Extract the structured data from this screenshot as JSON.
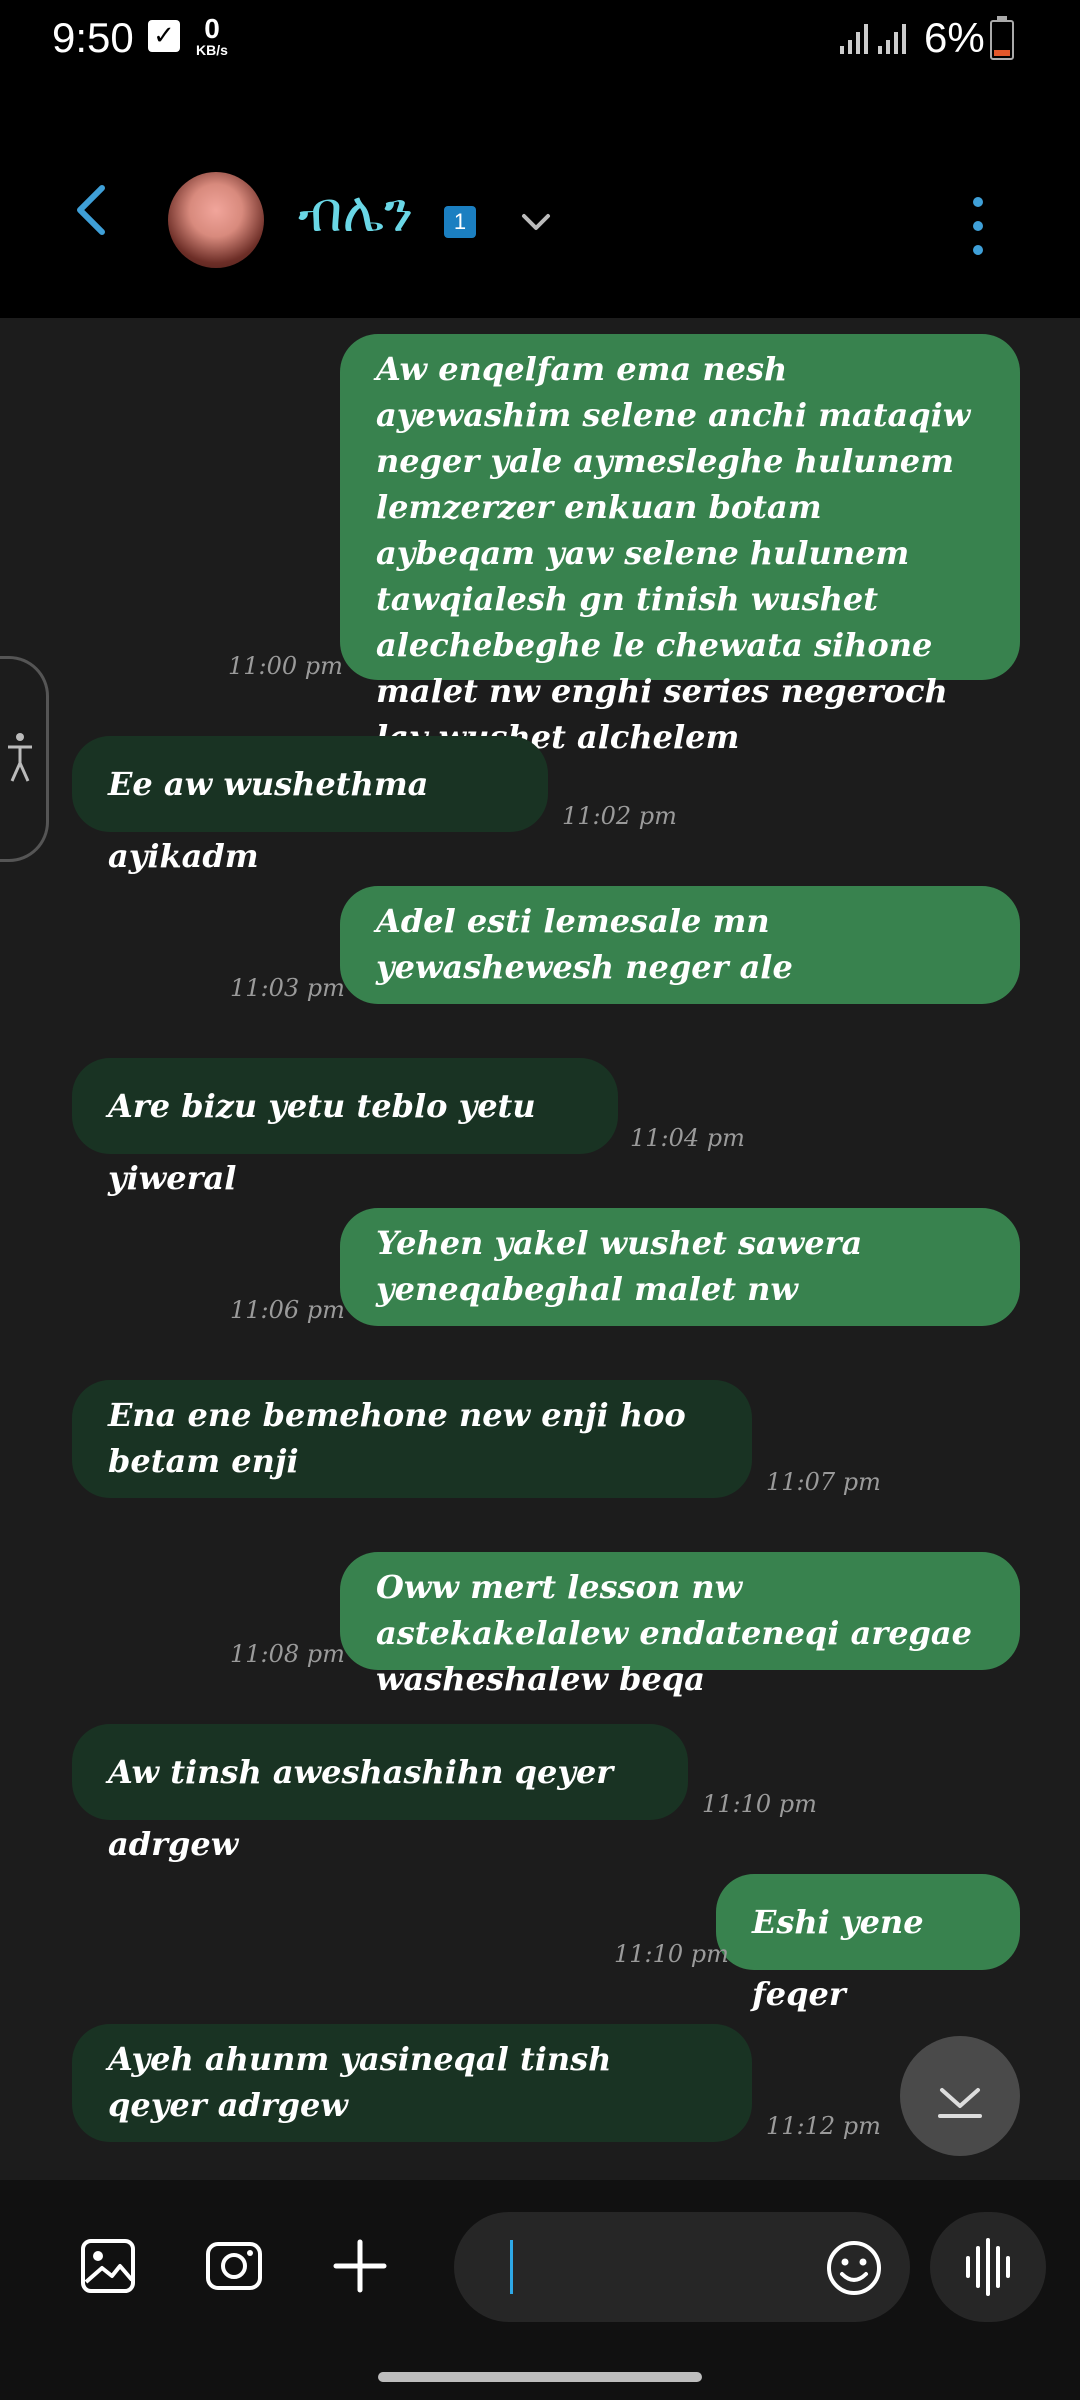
{
  "status_bar": {
    "time": "9:50",
    "net_speed": "0",
    "net_unit": "KB/s",
    "battery": "6%"
  },
  "header": {
    "contact_name": "ብሌን",
    "badge": "1"
  },
  "messages": [
    {
      "type": "sent",
      "text": "Aw enqelfam ema nesh ayewashim selene anchi mataqiw neger yale aymesleghe hulunem lemzerzer enkuan botam aybeqam yaw selene hulunem tawqialesh gn tinish wushet alechebeghe le chewata sihone malet nw enghi series negeroch lay wushet alchelem",
      "time": "11:00 pm"
    },
    {
      "type": "received",
      "text": "Ee aw wushethma ayikadm",
      "time": "11:02 pm"
    },
    {
      "type": "sent",
      "text": "Adel esti lemesale mn yewashewesh neger ale",
      "time": "11:03 pm"
    },
    {
      "type": "received",
      "text": "Are bizu yetu teblo yetu yiweral",
      "time": "11:04 pm"
    },
    {
      "type": "sent",
      "text": "Yehen yakel wushet sawera yeneqabeghal malet nw",
      "time": "11:06 pm"
    },
    {
      "type": "received",
      "text": "Ena ene bemehone new enji hoo betam enji",
      "time": "11:07 pm"
    },
    {
      "type": "sent",
      "text": "Oww mert lesson nw astekakelalew endateneqi aregae washeshalew beqa",
      "time": "11:08 pm"
    },
    {
      "type": "received",
      "text": "Aw tinsh aweshashihn qeyer adrgew",
      "time": "11:10 pm"
    },
    {
      "type": "sent",
      "text": "Eshi yene feqer",
      "time": "11:10 pm"
    },
    {
      "type": "received",
      "text": "Ayeh ahunm yasineqal tinsh qeyer adrgew",
      "time": "11:12 pm"
    }
  ],
  "icons": {
    "back": "chevron-left-icon",
    "more": "more-vertical-icon",
    "dropdown": "chevron-down-icon",
    "gallery": "gallery-icon",
    "camera": "camera-icon",
    "attach": "plus-icon",
    "emoji": "emoji-icon",
    "voice": "voice-wave-icon",
    "scroll": "scroll-down-icon"
  },
  "colors": {
    "sent_bubble": "#38824e",
    "received_bubble": "#193323",
    "contact_name": "#6ad7e6",
    "background": "#1c1c1c"
  }
}
